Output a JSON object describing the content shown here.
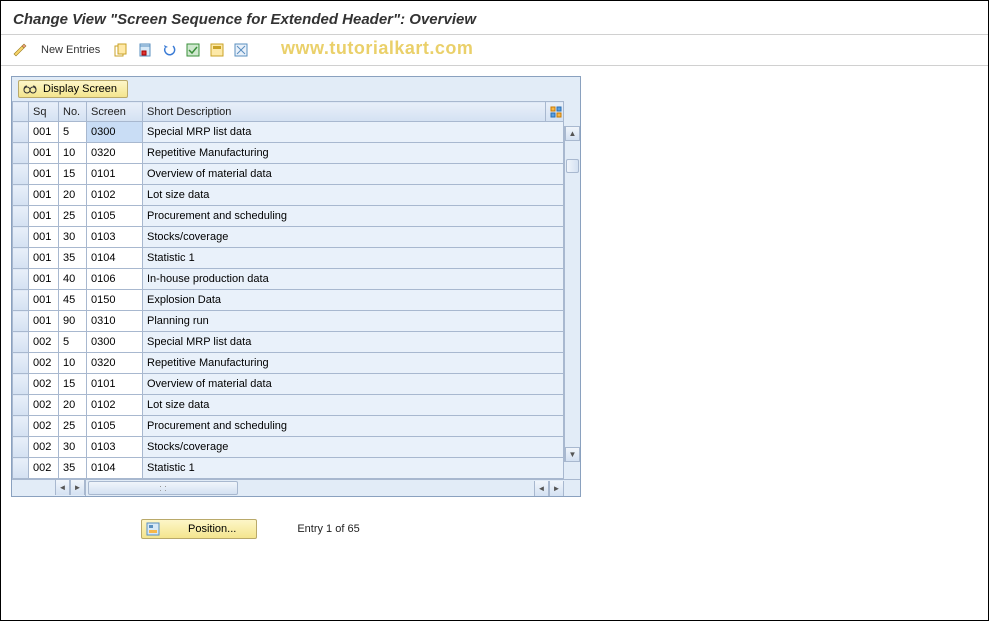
{
  "title": "Change View \"Screen Sequence for Extended Header\": Overview",
  "watermark": "www.tutorialkart.com",
  "toolbar": {
    "new_entries_label": "New Entries"
  },
  "table": {
    "display_screen_label": "Display Screen",
    "columns": {
      "sq": "Sq",
      "no": "No.",
      "screen": "Screen",
      "desc": "Short Description"
    },
    "rows": [
      {
        "sq": "001",
        "no": "5",
        "screen": "0300",
        "desc": "Special MRP list data",
        "selected": true
      },
      {
        "sq": "001",
        "no": "10",
        "screen": "0320",
        "desc": "Repetitive Manufacturing"
      },
      {
        "sq": "001",
        "no": "15",
        "screen": "0101",
        "desc": "Overview of material data"
      },
      {
        "sq": "001",
        "no": "20",
        "screen": "0102",
        "desc": "Lot size data"
      },
      {
        "sq": "001",
        "no": "25",
        "screen": "0105",
        "desc": "Procurement and scheduling"
      },
      {
        "sq": "001",
        "no": "30",
        "screen": "0103",
        "desc": "Stocks/coverage"
      },
      {
        "sq": "001",
        "no": "35",
        "screen": "0104",
        "desc": "Statistic 1"
      },
      {
        "sq": "001",
        "no": "40",
        "screen": "0106",
        "desc": "In-house production data"
      },
      {
        "sq": "001",
        "no": "45",
        "screen": "0150",
        "desc": "Explosion Data"
      },
      {
        "sq": "001",
        "no": "90",
        "screen": "0310",
        "desc": "Planning run"
      },
      {
        "sq": "002",
        "no": "5",
        "screen": "0300",
        "desc": "Special MRP list data"
      },
      {
        "sq": "002",
        "no": "10",
        "screen": "0320",
        "desc": "Repetitive Manufacturing"
      },
      {
        "sq": "002",
        "no": "15",
        "screen": "0101",
        "desc": "Overview of material data"
      },
      {
        "sq": "002",
        "no": "20",
        "screen": "0102",
        "desc": "Lot size data"
      },
      {
        "sq": "002",
        "no": "25",
        "screen": "0105",
        "desc": "Procurement and scheduling"
      },
      {
        "sq": "002",
        "no": "30",
        "screen": "0103",
        "desc": "Stocks/coverage"
      },
      {
        "sq": "002",
        "no": "35",
        "screen": "0104",
        "desc": "Statistic 1"
      }
    ]
  },
  "footer": {
    "position_label": "Position...",
    "entry_label": "Entry 1 of 65"
  }
}
